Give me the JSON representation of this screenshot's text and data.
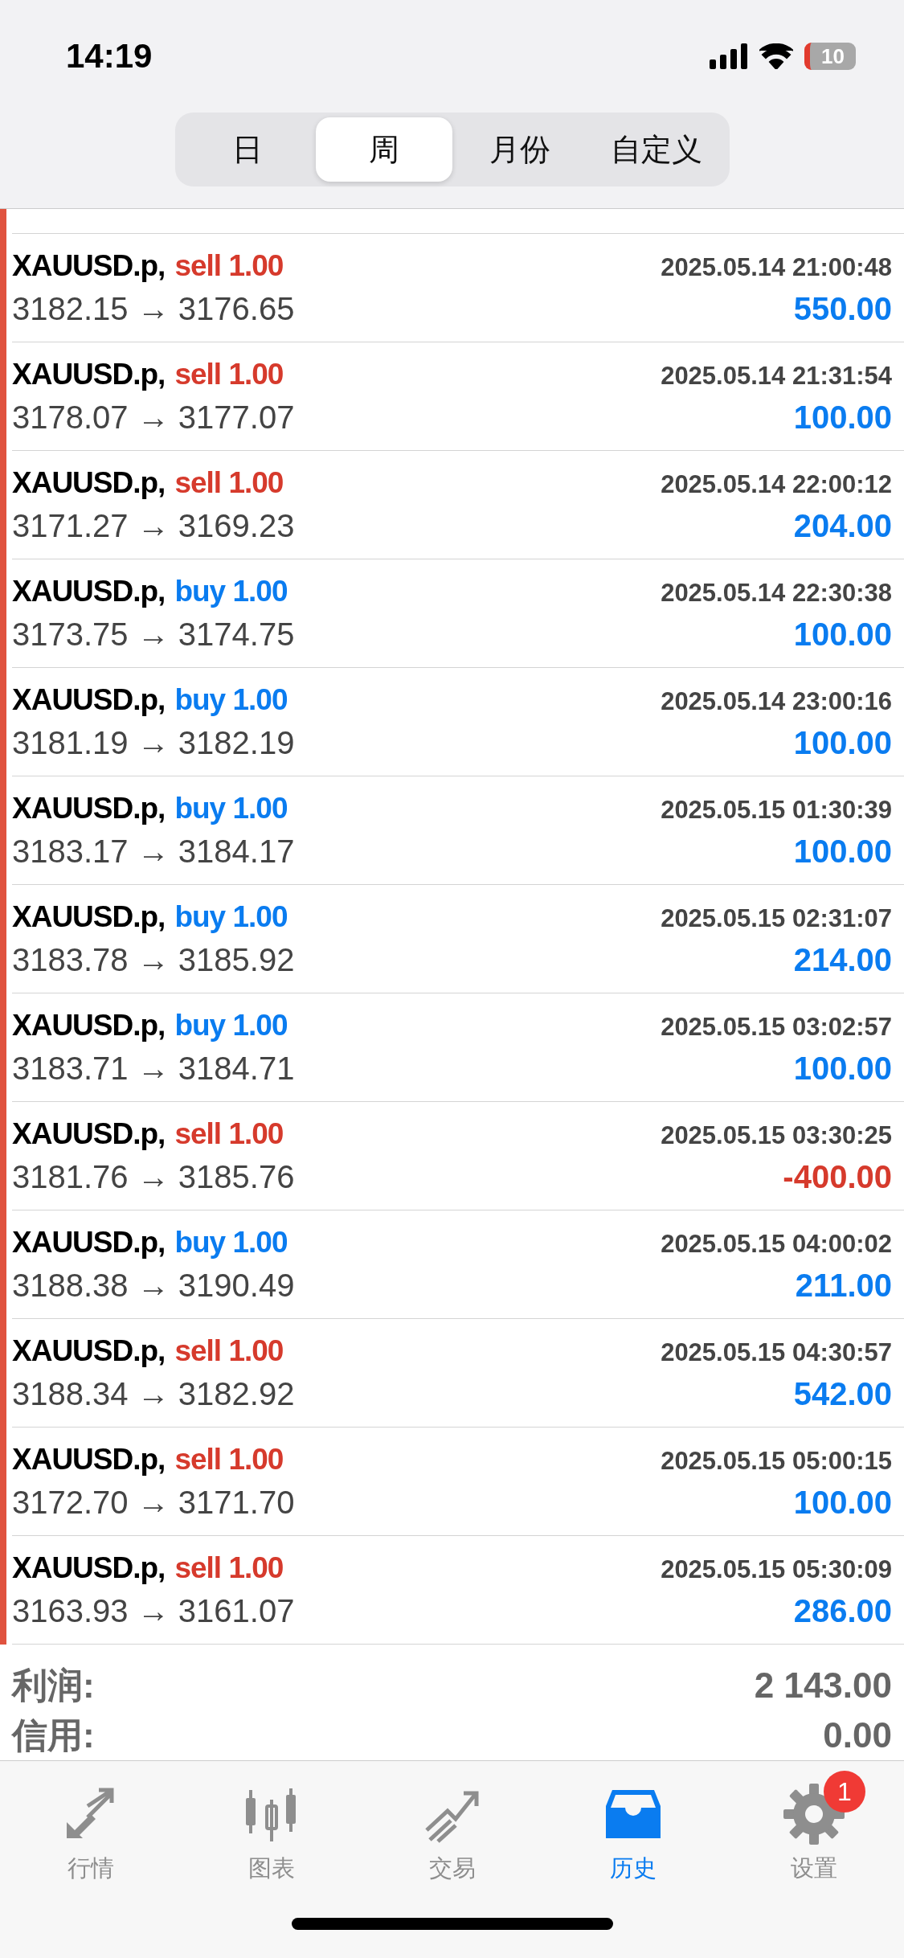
{
  "status_bar": {
    "time": "14:19",
    "battery": "10"
  },
  "segments": [
    {
      "label": "日",
      "selected": false
    },
    {
      "label": "周",
      "selected": true
    },
    {
      "label": "月份",
      "selected": false
    },
    {
      "label": "自定义",
      "selected": false
    }
  ],
  "trades": [
    {
      "symbol": "XAUUSD.p,",
      "kind": "sell",
      "order": "sell 1.00",
      "time": "2025.05.14 21:00:48",
      "prices": "3182.15 → 3176.65",
      "profit": "550.00",
      "loss": false
    },
    {
      "symbol": "XAUUSD.p,",
      "kind": "sell",
      "order": "sell 1.00",
      "time": "2025.05.14 21:31:54",
      "prices": "3178.07 → 3177.07",
      "profit": "100.00",
      "loss": false
    },
    {
      "symbol": "XAUUSD.p,",
      "kind": "sell",
      "order": "sell 1.00",
      "time": "2025.05.14 22:00:12",
      "prices": "3171.27 → 3169.23",
      "profit": "204.00",
      "loss": false
    },
    {
      "symbol": "XAUUSD.p,",
      "kind": "buy",
      "order": "buy 1.00",
      "time": "2025.05.14 22:30:38",
      "prices": "3173.75 → 3174.75",
      "profit": "100.00",
      "loss": false
    },
    {
      "symbol": "XAUUSD.p,",
      "kind": "buy",
      "order": "buy 1.00",
      "time": "2025.05.14 23:00:16",
      "prices": "3181.19 → 3182.19",
      "profit": "100.00",
      "loss": false
    },
    {
      "symbol": "XAUUSD.p,",
      "kind": "buy",
      "order": "buy 1.00",
      "time": "2025.05.15 01:30:39",
      "prices": "3183.17 → 3184.17",
      "profit": "100.00",
      "loss": false
    },
    {
      "symbol": "XAUUSD.p,",
      "kind": "buy",
      "order": "buy 1.00",
      "time": "2025.05.15 02:31:07",
      "prices": "3183.78 → 3185.92",
      "profit": "214.00",
      "loss": false
    },
    {
      "symbol": "XAUUSD.p,",
      "kind": "buy",
      "order": "buy 1.00",
      "time": "2025.05.15 03:02:57",
      "prices": "3183.71 → 3184.71",
      "profit": "100.00",
      "loss": false
    },
    {
      "symbol": "XAUUSD.p,",
      "kind": "sell",
      "order": "sell 1.00",
      "time": "2025.05.15 03:30:25",
      "prices": "3181.76 → 3185.76",
      "profit": "-400.00",
      "loss": true
    },
    {
      "symbol": "XAUUSD.p,",
      "kind": "buy",
      "order": "buy 1.00",
      "time": "2025.05.15 04:00:02",
      "prices": "3188.38 → 3190.49",
      "profit": "211.00",
      "loss": false
    },
    {
      "symbol": "XAUUSD.p,",
      "kind": "sell",
      "order": "sell 1.00",
      "time": "2025.05.15 04:30:57",
      "prices": "3188.34 → 3182.92",
      "profit": "542.00",
      "loss": false
    },
    {
      "symbol": "XAUUSD.p,",
      "kind": "sell",
      "order": "sell 1.00",
      "time": "2025.05.15 05:00:15",
      "prices": "3172.70 → 3171.70",
      "profit": "100.00",
      "loss": false
    },
    {
      "symbol": "XAUUSD.p,",
      "kind": "sell",
      "order": "sell 1.00",
      "time": "2025.05.15 05:30:09",
      "prices": "3163.93 → 3161.07",
      "profit": "286.00",
      "loss": false
    }
  ],
  "summary": [
    {
      "label": "利润:",
      "value": "2 143.00"
    },
    {
      "label": "信用:",
      "value": "0.00"
    }
  ],
  "tab_bar": [
    {
      "kind": "quotes",
      "label": "行情",
      "selected": false
    },
    {
      "kind": "chart",
      "label": "图表",
      "selected": false
    },
    {
      "kind": "trade",
      "label": "交易",
      "selected": false
    },
    {
      "kind": "history",
      "label": "历史",
      "selected": true
    },
    {
      "kind": "settings",
      "label": "设置",
      "selected": false,
      "badge": "1"
    }
  ]
}
